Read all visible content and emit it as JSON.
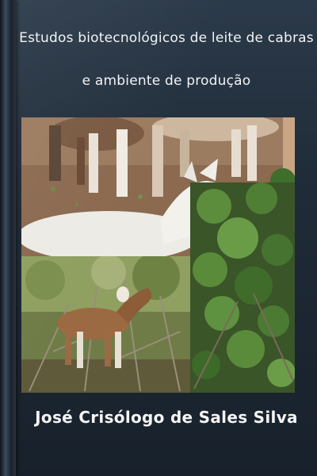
{
  "book": {
    "title_line1": "Estudos biotecnológicos de leite de cabras",
    "title_line2": "e ambiente de produção",
    "author": "José Crisólogo de Sales Silva"
  },
  "images": {
    "top": "white-goat-eating-leaves",
    "bottom_left": "brown-goat-in-scrub",
    "bottom_right": "green-leafy-shrub"
  }
}
